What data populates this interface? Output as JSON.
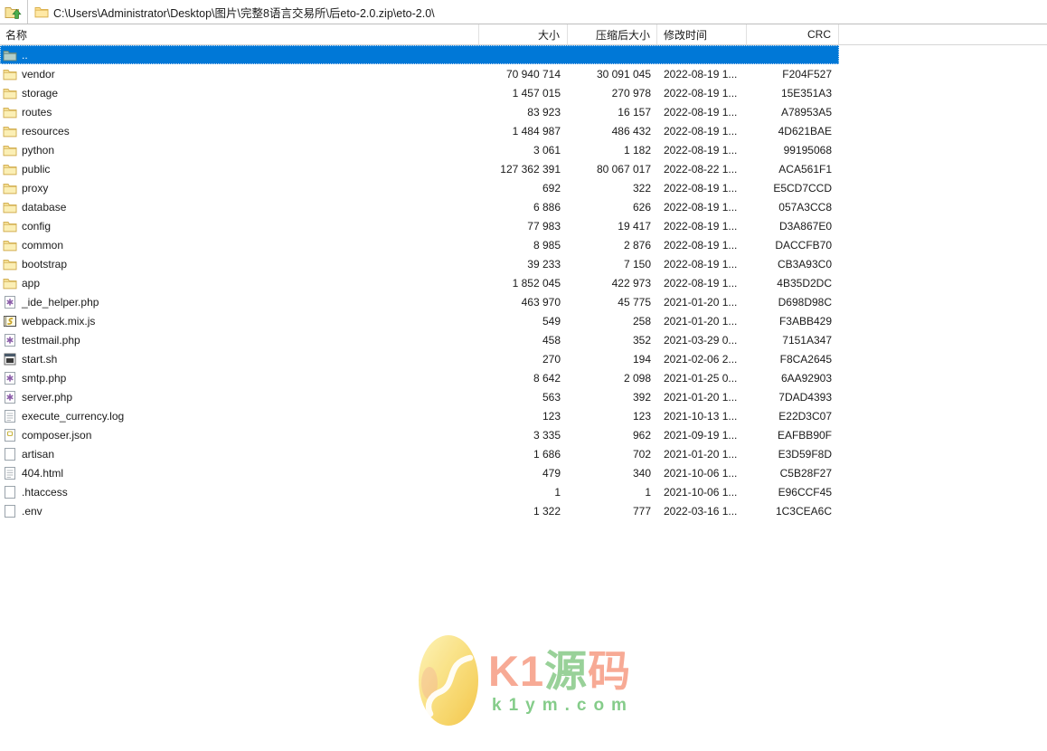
{
  "toolbar": {
    "path": "C:\\Users\\Administrator\\Desktop\\图片\\完整8语言交易所\\后eto-2.0.zip\\eto-2.0\\"
  },
  "table": {
    "columns": {
      "name": "名称",
      "size": "大小",
      "packed": "压缩后大小",
      "modified": "修改时间",
      "crc": "CRC"
    }
  },
  "rows": [
    {
      "name": "..",
      "icon": "parent-folder",
      "size": "",
      "packed": "",
      "modified": "",
      "crc": "",
      "selected": true
    },
    {
      "name": "vendor",
      "icon": "folder",
      "size": "70 940 714",
      "packed": "30 091 045",
      "modified": "2022-08-19 1...",
      "crc": "F204F527"
    },
    {
      "name": "storage",
      "icon": "folder",
      "size": "1 457 015",
      "packed": "270 978",
      "modified": "2022-08-19 1...",
      "crc": "15E351A3"
    },
    {
      "name": "routes",
      "icon": "folder",
      "size": "83 923",
      "packed": "16 157",
      "modified": "2022-08-19 1...",
      "crc": "A78953A5"
    },
    {
      "name": "resources",
      "icon": "folder",
      "size": "1 484 987",
      "packed": "486 432",
      "modified": "2022-08-19 1...",
      "crc": "4D621BAE"
    },
    {
      "name": "python",
      "icon": "folder",
      "size": "3 061",
      "packed": "1 182",
      "modified": "2022-08-19 1...",
      "crc": "99195068"
    },
    {
      "name": "public",
      "icon": "folder",
      "size": "127 362 391",
      "packed": "80 067 017",
      "modified": "2022-08-22 1...",
      "crc": "ACA561F1"
    },
    {
      "name": "proxy",
      "icon": "folder",
      "size": "692",
      "packed": "322",
      "modified": "2022-08-19 1...",
      "crc": "E5CD7CCD"
    },
    {
      "name": "database",
      "icon": "folder",
      "size": "6 886",
      "packed": "626",
      "modified": "2022-08-19 1...",
      "crc": "057A3CC8"
    },
    {
      "name": "config",
      "icon": "folder",
      "size": "77 983",
      "packed": "19 417",
      "modified": "2022-08-19 1...",
      "crc": "D3A867E0"
    },
    {
      "name": "common",
      "icon": "folder",
      "size": "8 985",
      "packed": "2 876",
      "modified": "2022-08-19 1...",
      "crc": "DACCFB70"
    },
    {
      "name": "bootstrap",
      "icon": "folder",
      "size": "39 233",
      "packed": "7 150",
      "modified": "2022-08-19 1...",
      "crc": "CB3A93C0"
    },
    {
      "name": "app",
      "icon": "folder",
      "size": "1 852 045",
      "packed": "422 973",
      "modified": "2022-08-19 1...",
      "crc": "4B35D2DC"
    },
    {
      "name": "_ide_helper.php",
      "icon": "php-file",
      "size": "463 970",
      "packed": "45 775",
      "modified": "2021-01-20 1...",
      "crc": "D698D98C"
    },
    {
      "name": "webpack.mix.js",
      "icon": "js-file",
      "size": "549",
      "packed": "258",
      "modified": "2021-01-20 1...",
      "crc": "F3ABB429"
    },
    {
      "name": "testmail.php",
      "icon": "php-file",
      "size": "458",
      "packed": "352",
      "modified": "2021-03-29 0...",
      "crc": "7151A347"
    },
    {
      "name": "start.sh",
      "icon": "shell-file",
      "size": "270",
      "packed": "194",
      "modified": "2021-02-06 2...",
      "crc": "F8CA2645"
    },
    {
      "name": "smtp.php",
      "icon": "php-file",
      "size": "8 642",
      "packed": "2 098",
      "modified": "2021-01-25 0...",
      "crc": "6AA92903"
    },
    {
      "name": "server.php",
      "icon": "php-file",
      "size": "563",
      "packed": "392",
      "modified": "2021-01-20 1...",
      "crc": "7DAD4393"
    },
    {
      "name": "execute_currency.log",
      "icon": "log-file",
      "size": "123",
      "packed": "123",
      "modified": "2021-10-13 1...",
      "crc": "E22D3C07"
    },
    {
      "name": "composer.json",
      "icon": "json-file",
      "size": "3 335",
      "packed": "962",
      "modified": "2021-09-19 1...",
      "crc": "EAFBB90F"
    },
    {
      "name": "artisan",
      "icon": "file",
      "size": "1 686",
      "packed": "702",
      "modified": "2021-01-20 1...",
      "crc": "E3D59F8D"
    },
    {
      "name": "404.html",
      "icon": "html-file",
      "size": "479",
      "packed": "340",
      "modified": "2021-10-06 1...",
      "crc": "C5B28F27"
    },
    {
      "name": ".htaccess",
      "icon": "file",
      "size": "1",
      "packed": "1",
      "modified": "2021-10-06 1...",
      "crc": "E96CCF45"
    },
    {
      "name": ".env",
      "icon": "file",
      "size": "1 322",
      "packed": "777",
      "modified": "2022-03-16 1...",
      "crc": "1C3CEA6C"
    }
  ],
  "watermark": {
    "brand_k1": "K1",
    "brand_yuan": "源",
    "brand_ma": "码",
    "domain": "k1ym.com"
  },
  "colors": {
    "selection-blue": "#0078D7",
    "folder-yellow": "#F7E49C",
    "wm-salmon": "#F7A48E",
    "wm-green": "#92CE92",
    "wm-domain-green": "#7CC982",
    "wm-egg-gold": "#F6CB4A"
  }
}
